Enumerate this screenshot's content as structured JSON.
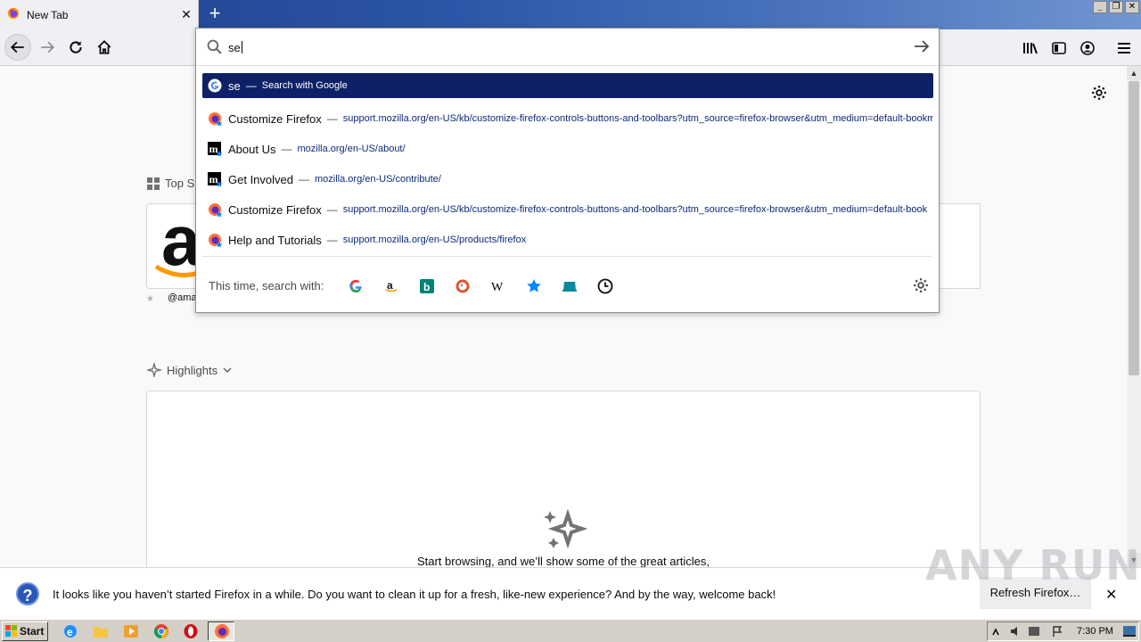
{
  "tab": {
    "title": "New Tab",
    "close": "✕"
  },
  "newtab": "+",
  "window_controls": [
    "_",
    "❐",
    "✕"
  ],
  "urlbar": {
    "value": "se",
    "results": [
      {
        "title": "se",
        "sep": "—",
        "url": "Search with Google",
        "icon": "google-icon",
        "selected": true
      },
      {
        "title": "Customize Firefox",
        "sep": "—",
        "url": "support.mozilla.org/en-US/kb/customize-firefox-controls-buttons-and-toolbars?utm_source=firefox-browser&utm_medium=default-bookm",
        "icon": "firefox-bookmark-icon"
      },
      {
        "title": "About Us",
        "sep": "—",
        "url": "mozilla.org/en-US/about/",
        "icon": "mozilla-bookmark-icon"
      },
      {
        "title": "Get Involved",
        "sep": "—",
        "url": "mozilla.org/en-US/contribute/",
        "icon": "mozilla-bookmark-icon"
      },
      {
        "title": "Customize Firefox",
        "sep": "—",
        "url": "support.mozilla.org/en-US/kb/customize-firefox-controls-buttons-and-toolbars?utm_source=firefox-browser&utm_medium=default-book",
        "icon": "firefox-bookmark-icon"
      },
      {
        "title": "Help and Tutorials",
        "sep": "—",
        "url": "support.mozilla.org/en-US/products/firefox",
        "icon": "firefox-bookmark-icon"
      }
    ],
    "oneoff_label": "This time, search with:",
    "engines": [
      "google",
      "amazon",
      "bing",
      "duckduckgo",
      "wikipedia",
      "bookmarks",
      "tabs",
      "history"
    ]
  },
  "newtab_page": {
    "topsites_label": "Top S",
    "amazon_caption": "@ama",
    "highlights_label": "Highlights",
    "empty_text": "Start browsing, and we’ll show some of the great articles,"
  },
  "notification": {
    "text": "It looks like you haven’t started Firefox in a while. Do you want to clean it up for a fresh, like-new experience? And by the way, welcome back!",
    "button": "Refresh Firefox…",
    "close": "✕"
  },
  "watermark": "ANY RUN",
  "taskbar": {
    "start": "Start",
    "clock": "7:30 PM"
  },
  "colors": {
    "selected_row": "#0e2166",
    "titlebar": "#2d56a8"
  }
}
